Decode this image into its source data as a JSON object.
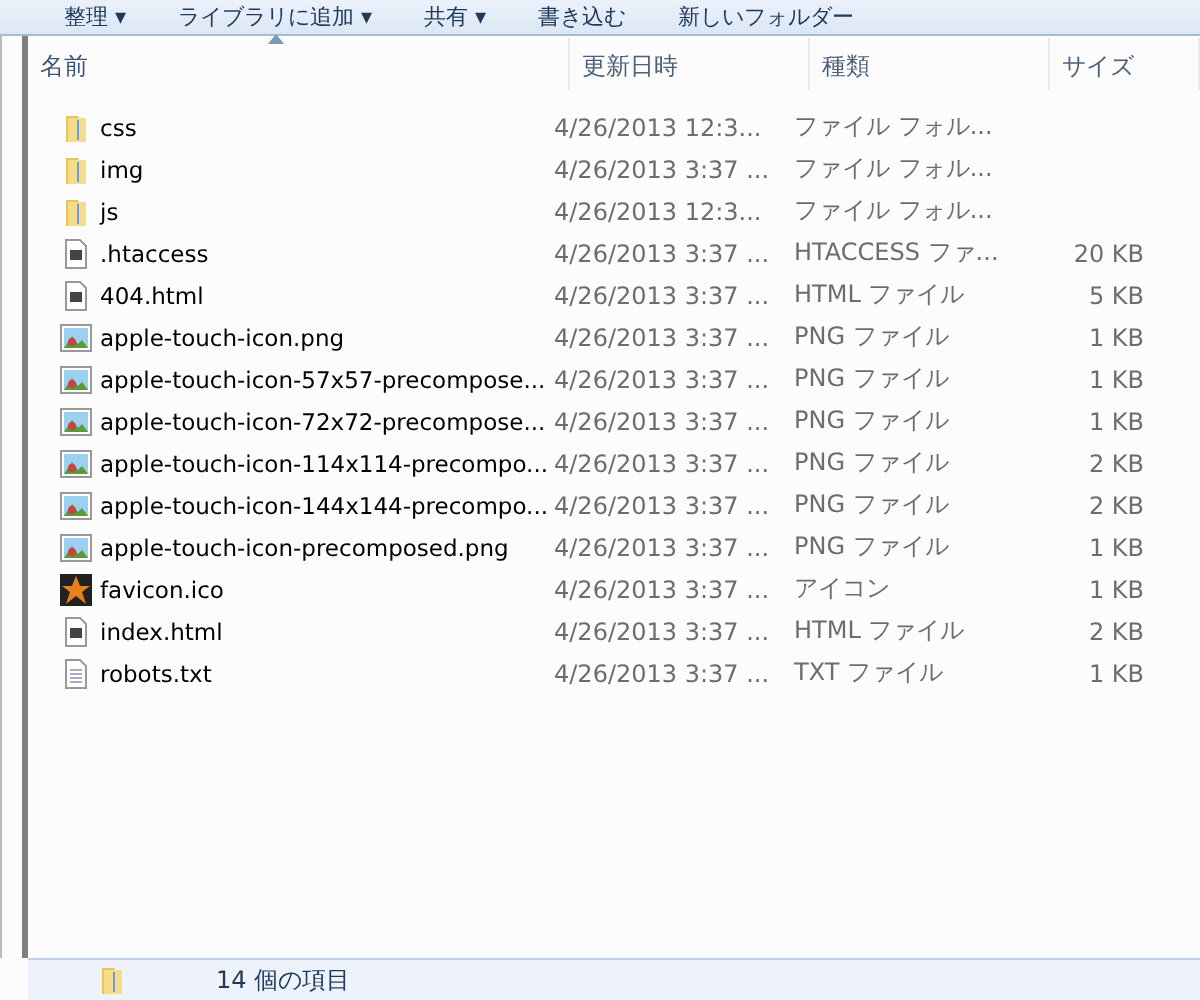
{
  "toolbar": [
    "整理 ▾",
    "ライブラリに追加 ▾",
    "共有 ▾",
    "書き込む",
    "新しいフォルダー"
  ],
  "columns": [
    {
      "label": "名前",
      "sorted": true
    },
    {
      "label": "更新日時",
      "sorted": false
    },
    {
      "label": "種類",
      "sorted": false
    },
    {
      "label": "サイズ",
      "sorted": false
    }
  ],
  "rows": [
    {
      "kind": "folder",
      "name": "css",
      "date": "4/26/2013 12:3...",
      "type": "ファイル フォル..."
    },
    {
      "kind": "folder",
      "name": "img",
      "date": "4/26/2013 3:37 ...",
      "type": "ファイル フォル..."
    },
    {
      "kind": "folder",
      "name": "js",
      "date": "4/26/2013 12:3...",
      "type": "ファイル フォル..."
    },
    {
      "kind": "file",
      "name": ".htaccess",
      "date": "4/26/2013 3:37 ...",
      "type": "HTACCESS ファ...",
      "size": "20 KB"
    },
    {
      "kind": "file",
      "name": "404.html",
      "date": "4/26/2013 3:37 ...",
      "type": "HTML ファイル",
      "size": "5 KB"
    },
    {
      "kind": "image",
      "name": "apple-touch-icon.png",
      "date": "4/26/2013 3:37 ...",
      "type": "PNG ファイル",
      "size": "1 KB"
    },
    {
      "kind": "image",
      "name": "apple-touch-icon-57x57-precompose...",
      "date": "4/26/2013 3:37 ...",
      "type": "PNG ファイル",
      "size": "1 KB"
    },
    {
      "kind": "image",
      "name": "apple-touch-icon-72x72-precompose...",
      "date": "4/26/2013 3:37 ...",
      "type": "PNG ファイル",
      "size": "1 KB"
    },
    {
      "kind": "image",
      "name": "apple-touch-icon-114x114-precompo...",
      "date": "4/26/2013 3:37 ...",
      "type": "PNG ファイル",
      "size": "2 KB"
    },
    {
      "kind": "image",
      "name": "apple-touch-icon-144x144-precompo...",
      "date": "4/26/2013 3:37 ...",
      "type": "PNG ファイル",
      "size": "2 KB"
    },
    {
      "kind": "image",
      "name": "apple-touch-icon-precomposed.png",
      "date": "4/26/2013 3:37 ...",
      "type": "PNG ファイル",
      "size": "1 KB"
    },
    {
      "kind": "star",
      "name": "favicon.ico",
      "date": "4/26/2013 3:37 ...",
      "type": "アイコン",
      "size": "1 KB"
    },
    {
      "kind": "file",
      "name": "index.html",
      "date": "4/26/2013 3:37 ...",
      "type": "HTML ファイル",
      "size": "2 KB"
    },
    {
      "kind": "text",
      "name": "robots.txt",
      "date": "4/26/2013 3:37 ...",
      "type": "TXT ファイル",
      "size": "1 KB"
    }
  ],
  "status_bar": {
    "count": "14 個の項目"
  }
}
